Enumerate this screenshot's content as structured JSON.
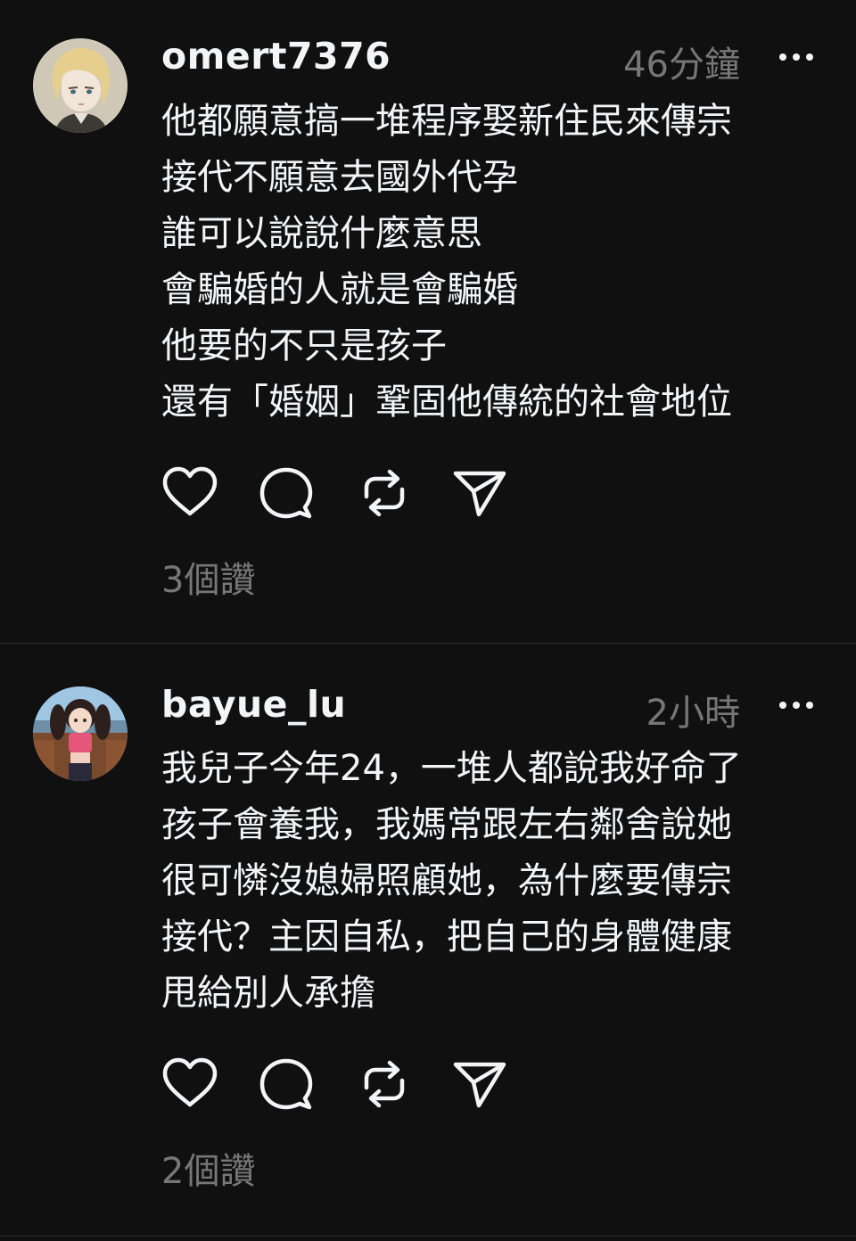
{
  "posts": [
    {
      "username": "omert7376",
      "timestamp": "46分鐘",
      "avatar": "anime-short-hair-avatar",
      "lines": [
        "他都願意搞一堆程序娶新住民來傳宗",
        "接代不願意去國外代孕",
        "誰可以說說什麼意思",
        "會騙婚的人就是會騙婚",
        "他要的不只是孩子",
        "還有「婚姻」鞏固他傳統的社會地位"
      ],
      "likes": "3個讚"
    },
    {
      "username": "bayue_lu",
      "timestamp": "2小時",
      "avatar": "anime-girl-twin-tails-avatar",
      "lines": [
        "我兒子今年24，一堆人都說我好命了",
        "孩子會養我，我媽常跟左右鄰舍說她",
        "很可憐沒媳婦照顧她，為什麼要傳宗",
        "接代？主因自私，把自己的身體健康",
        "甩給別人承擔"
      ],
      "likes": "2個讚"
    }
  ],
  "icons": {
    "like": "heart-icon",
    "comment": "comment-bubble-icon",
    "repost": "repost-arrows-icon",
    "share": "paper-plane-icon",
    "more": "more-dots-icon"
  },
  "colors": {
    "background": "#101010",
    "text_primary": "#f3f5f7",
    "text_secondary": "#777777",
    "divider": "#2e2e2e"
  }
}
